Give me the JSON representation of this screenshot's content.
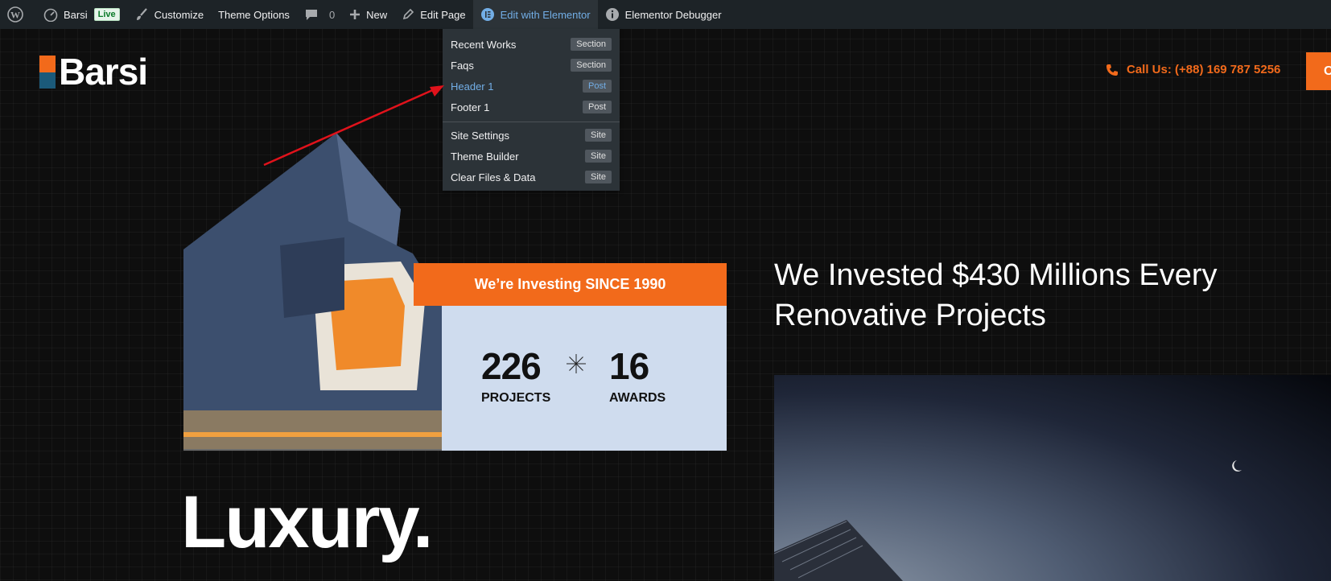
{
  "adminbar": {
    "site_name": "Barsi",
    "live_badge": "Live",
    "customize": "Customize",
    "theme_options": "Theme Options",
    "comments_count": "0",
    "new": "New",
    "edit_page": "Edit Page",
    "edit_with_elementor": "Edit with Elementor",
    "elementor_debugger": "Elementor Debugger"
  },
  "dropdown": {
    "items": [
      {
        "label": "Recent Works",
        "tag": "Section"
      },
      {
        "label": "Faqs",
        "tag": "Section"
      },
      {
        "label": "Header 1",
        "tag": "Post"
      },
      {
        "label": "Footer 1",
        "tag": "Post"
      },
      {
        "label": "Site Settings",
        "tag": "Site"
      },
      {
        "label": "Theme Builder",
        "tag": "Site"
      },
      {
        "label": "Clear Files & Data",
        "tag": "Site"
      }
    ]
  },
  "site": {
    "logo": "Barsi",
    "call": "Call Us: (+88) 169 787 5256",
    "cta_partial": "C"
  },
  "card": {
    "banner": "We’re Investing SINCE 1990",
    "stat1_num": "226",
    "stat1_label": "PROJECTS",
    "stat2_num": "16",
    "stat2_label": "AWARDS"
  },
  "headline_line1": "We Invested $430 Millions Every",
  "headline_line2": "Renovative Projects",
  "luxury": "Luxury.",
  "colors": {
    "accent": "#f26a1b",
    "adminbar": "#1d2327",
    "card_bg": "#cfdcee",
    "link_blue": "#72aee6"
  }
}
